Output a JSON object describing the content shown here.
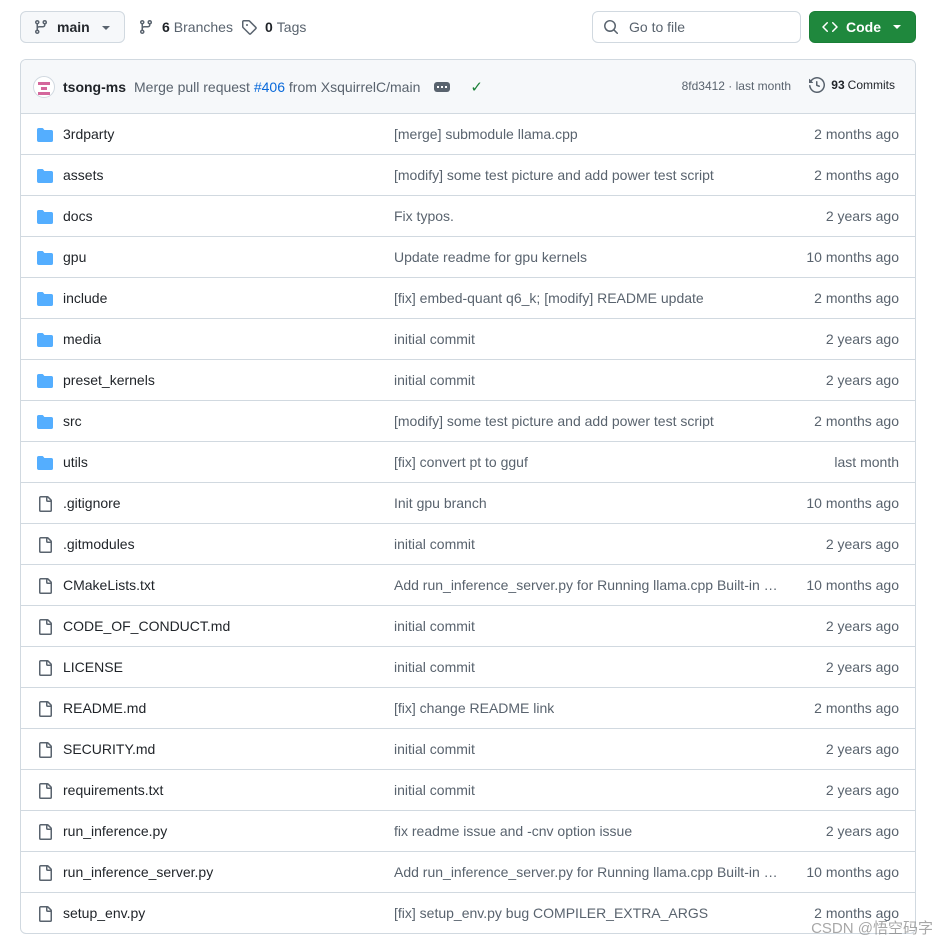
{
  "topbar": {
    "branch": "main",
    "branches_count": "6",
    "branches_label": "Branches",
    "tags_count": "0",
    "tags_label": "Tags",
    "search_placeholder": "Go to file",
    "code_label": "Code"
  },
  "commit": {
    "author": "tsong-ms",
    "message_prefix": "Merge pull request",
    "pr": "#406",
    "message_suffix": "from XsquirrelC/main",
    "sha_info": "8fd3412 · last month",
    "commits_count": "93",
    "commits_label": "Commits"
  },
  "files": [
    {
      "type": "dir",
      "name": "3rdparty",
      "message": "[merge] submodule llama.cpp",
      "age": "2 months ago"
    },
    {
      "type": "dir",
      "name": "assets",
      "message": "[modify] some test picture and add power test script",
      "age": "2 months ago"
    },
    {
      "type": "dir",
      "name": "docs",
      "message": "Fix typos.",
      "age": "2 years ago"
    },
    {
      "type": "dir",
      "name": "gpu",
      "message": "Update readme for gpu kernels",
      "age": "10 months ago"
    },
    {
      "type": "dir",
      "name": "include",
      "message": "[fix] embed-quant q6_k; [modify] README update",
      "age": "2 months ago"
    },
    {
      "type": "dir",
      "name": "media",
      "message": "initial commit",
      "age": "2 years ago"
    },
    {
      "type": "dir",
      "name": "preset_kernels",
      "message": "initial commit",
      "age": "2 years ago"
    },
    {
      "type": "dir",
      "name": "src",
      "message": "[modify] some test picture and add power test script",
      "age": "2 months ago"
    },
    {
      "type": "dir",
      "name": "utils",
      "message": "[fix] convert pt to gguf",
      "age": "last month"
    },
    {
      "type": "file",
      "name": ".gitignore",
      "message": "Init gpu branch",
      "age": "10 months ago"
    },
    {
      "type": "file",
      "name": ".gitmodules",
      "message": "initial commit",
      "age": "2 years ago"
    },
    {
      "type": "file",
      "name": "CMakeLists.txt",
      "message": "Add run_inference_server.py for Running llama.cpp Built-in Server",
      "age": "10 months ago"
    },
    {
      "type": "file",
      "name": "CODE_OF_CONDUCT.md",
      "message": "initial commit",
      "age": "2 years ago"
    },
    {
      "type": "file",
      "name": "LICENSE",
      "message": "initial commit",
      "age": "2 years ago"
    },
    {
      "type": "file",
      "name": "README.md",
      "message": "[fix] change README link",
      "age": "2 months ago"
    },
    {
      "type": "file",
      "name": "SECURITY.md",
      "message": "initial commit",
      "age": "2 years ago"
    },
    {
      "type": "file",
      "name": "requirements.txt",
      "message": "initial commit",
      "age": "2 years ago"
    },
    {
      "type": "file",
      "name": "run_inference.py",
      "message": "fix readme issue and -cnv option issue",
      "age": "2 years ago"
    },
    {
      "type": "file",
      "name": "run_inference_server.py",
      "message": "Add run_inference_server.py for Running llama.cpp Built-in Server",
      "age": "10 months ago"
    },
    {
      "type": "file",
      "name": "setup_env.py",
      "message": "[fix] setup_env.py bug COMPILER_EXTRA_ARGS",
      "age": "2 months ago"
    }
  ],
  "watermark": "CSDN @悟空码字",
  "colors": {
    "folder": "#54aeff",
    "accent_green": "#1f883d",
    "link": "#0969da"
  }
}
